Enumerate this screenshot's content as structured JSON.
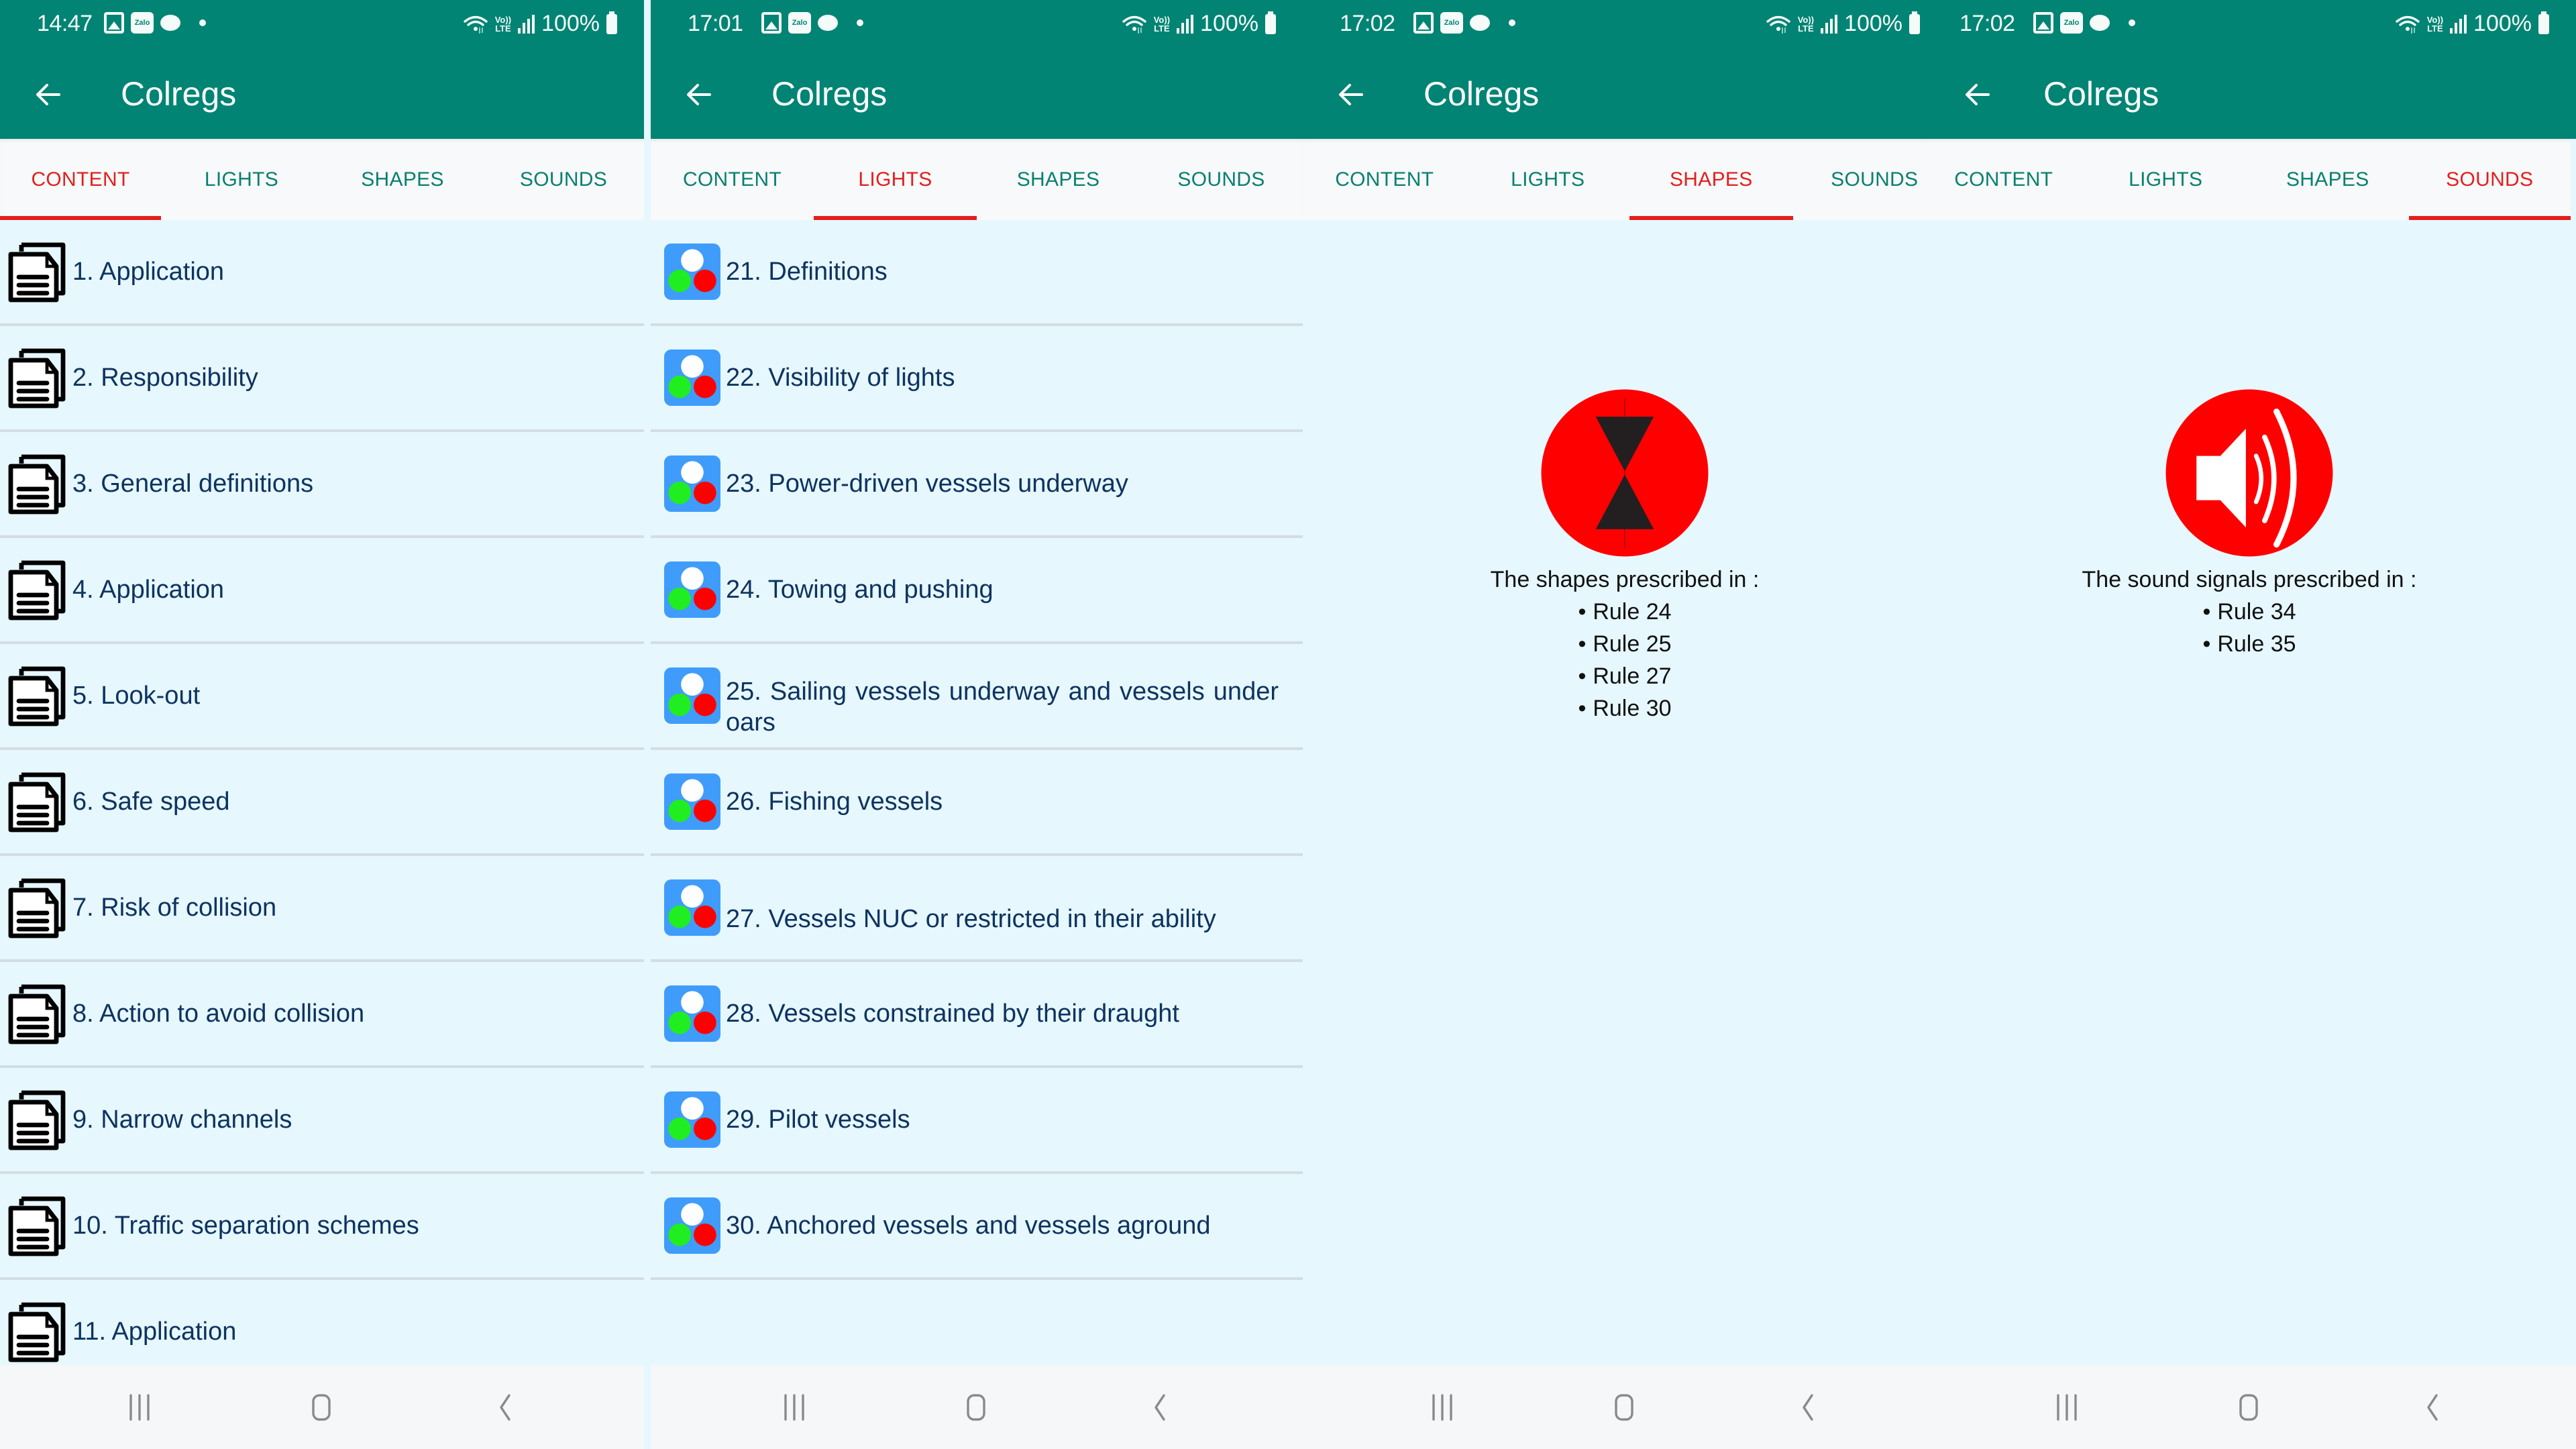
{
  "app": {
    "title": "Colregs",
    "back_icon": "arrow-left-icon",
    "tabs": [
      "CONTENT",
      "LIGHTS",
      "SHAPES",
      "SOUNDS"
    ]
  },
  "colors": {
    "app_bar": "#028474",
    "tab_text": "#078070",
    "tab_active": "#e21f1d",
    "content_bg": "#e6f7fe",
    "list_text": "#0e3360",
    "icon_red": "#ff0000",
    "light_icon_bg": "#3f9cfa"
  },
  "status_bars": [
    {
      "time": "14:47",
      "battery": "100%",
      "notifications": [
        "gallery-icon",
        "zalo-icon",
        "chat-icon",
        "dot-icon"
      ],
      "indicators": [
        "wifi-icon",
        "volte-icon",
        "signal-icon",
        "battery-icon"
      ],
      "lte_label_top": "Vo))",
      "lte_label_bottom": "LTE",
      "zalo_label": "Zalo"
    },
    {
      "time": "17:01",
      "battery": "100%",
      "notifications": [
        "gallery-icon",
        "zalo-icon",
        "chat-icon",
        "dot-icon"
      ],
      "indicators": [
        "wifi-icon",
        "volte-icon",
        "signal-icon",
        "battery-icon"
      ],
      "lte_label_top": "Vo))",
      "lte_label_bottom": "LTE",
      "zalo_label": "Zalo"
    },
    {
      "time": "17:02",
      "battery": "100%",
      "notifications": [
        "gallery-icon",
        "zalo-icon",
        "chat-icon",
        "dot-icon"
      ],
      "indicators": [
        "wifi-icon",
        "volte-icon",
        "signal-icon",
        "battery-icon"
      ],
      "lte_label_top": "Vo))",
      "lte_label_bottom": "LTE",
      "zalo_label": "Zalo"
    },
    {
      "time": "17:02",
      "battery": "100%",
      "notifications": [
        "gallery-icon",
        "zalo-icon",
        "chat-icon",
        "dot-icon"
      ],
      "indicators": [
        "wifi-icon",
        "volte-icon",
        "signal-icon",
        "battery-icon"
      ],
      "lte_label_top": "Vo))",
      "lte_label_bottom": "LTE",
      "zalo_label": "Zalo"
    }
  ],
  "panels": [
    {
      "active_tab": "CONTENT"
    },
    {
      "active_tab": "LIGHTS"
    },
    {
      "active_tab": "SHAPES"
    },
    {
      "active_tab": "SOUNDS"
    }
  ],
  "content_list": {
    "icon": "document-icon",
    "items": [
      "1. Application",
      "2. Responsibility",
      "3. General definitions",
      "4. Application",
      "5. Look-out",
      "6. Safe speed",
      "7. Risk of collision",
      "8. Action to avoid collision",
      "9. Narrow channels",
      "10. Traffic separation schemes",
      "11. Application"
    ]
  },
  "lights_list": {
    "icon": "navigation-lights-icon",
    "items": [
      "21. Definitions",
      "22. Visibility of lights",
      "23. Power-driven vessels underway",
      "24. Towing and pushing",
      "25. Sailing vessels underway and vessels under oars",
      "26. Fishing vessels",
      "27. Vessels NUC or restricted in their ability",
      "28. Vessels constrained by their draught",
      "29. Pilot vessels",
      "30. Anchored vessels and vessels aground"
    ]
  },
  "shapes": {
    "icon": "hourglass-shapes-icon",
    "caption": "The shapes prescribed in :",
    "rules": [
      "Rule 24",
      "Rule 25",
      "Rule 27",
      "Rule 30"
    ]
  },
  "sounds": {
    "icon": "speaker-icon",
    "caption": "The sound signals prescribed in :",
    "rules": [
      "Rule 34",
      "Rule 35"
    ]
  },
  "navbar": {
    "buttons": [
      "recent-apps-icon",
      "home-icon",
      "back-icon"
    ]
  }
}
